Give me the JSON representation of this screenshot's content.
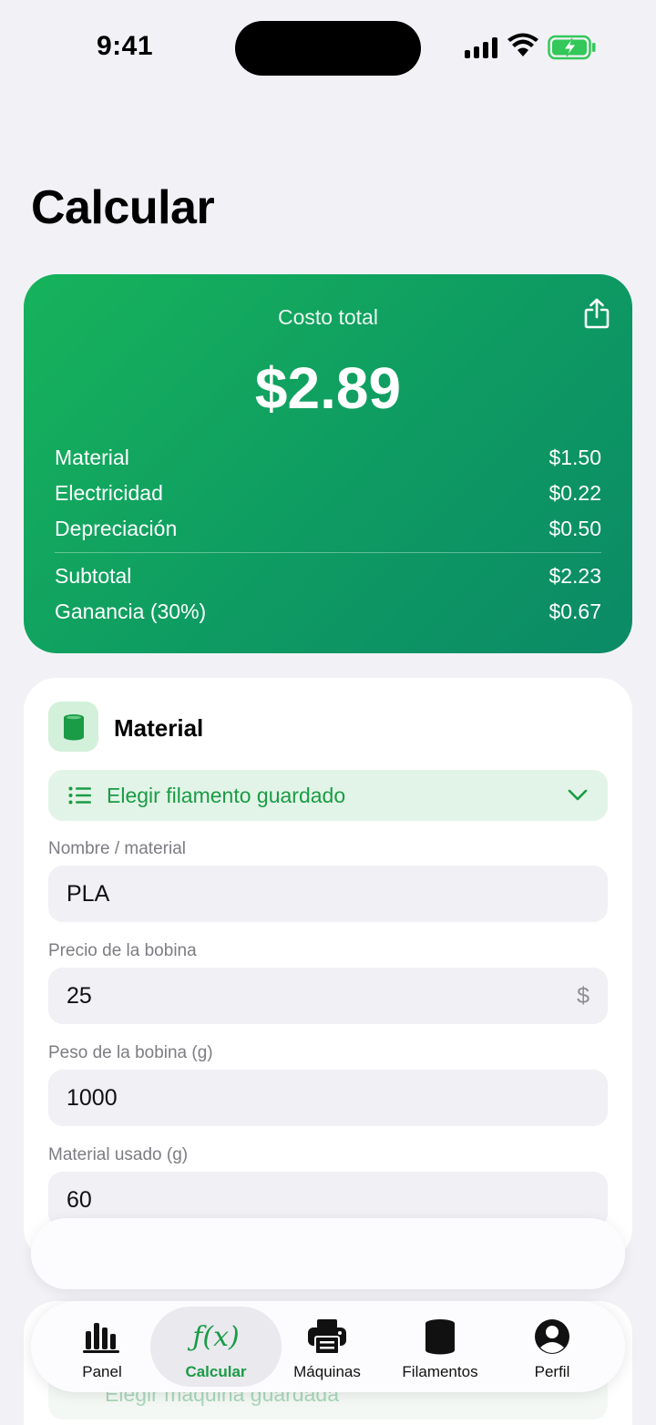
{
  "status_bar": {
    "time": "9:41"
  },
  "page": {
    "title": "Calcular"
  },
  "summary": {
    "label": "Costo total",
    "total": "$2.89",
    "rows": [
      {
        "label": "Material",
        "value": "$1.50"
      },
      {
        "label": "Electricidad",
        "value": "$0.22"
      },
      {
        "label": "Depreciación",
        "value": "$0.50"
      }
    ],
    "subtotal": {
      "label": "Subtotal",
      "value": "$2.23"
    },
    "profit": {
      "label": "Ganancia (30%)",
      "value": "$0.67"
    }
  },
  "material_section": {
    "title": "Material",
    "filament_select_label": "Elegir filamento guardado",
    "fields": {
      "name": {
        "label": "Nombre / material",
        "value": "PLA"
      },
      "spool_price": {
        "label": "Precio de la bobina",
        "value": "25",
        "suffix": "$"
      },
      "spool_weight": {
        "label": "Peso de la bobina (g)",
        "value": "1000"
      },
      "used": {
        "label": "Material usado (g)",
        "value": "60"
      }
    }
  },
  "machine_section": {
    "select_label": "Elegir máquina guardada"
  },
  "tab_bar": {
    "tabs": [
      {
        "label": "Panel",
        "icon": "chart-bar-icon"
      },
      {
        "label": "Calcular",
        "icon": "function-icon",
        "active": true
      },
      {
        "label": "Máquinas",
        "icon": "printer-icon"
      },
      {
        "label": "Filamentos",
        "icon": "cylinder-icon"
      },
      {
        "label": "Perfil",
        "icon": "person-circle-icon"
      }
    ]
  },
  "colors": {
    "accent": "#1a9b45",
    "card_gradient_start": "#17b35b",
    "card_gradient_end": "#0b8a66"
  }
}
